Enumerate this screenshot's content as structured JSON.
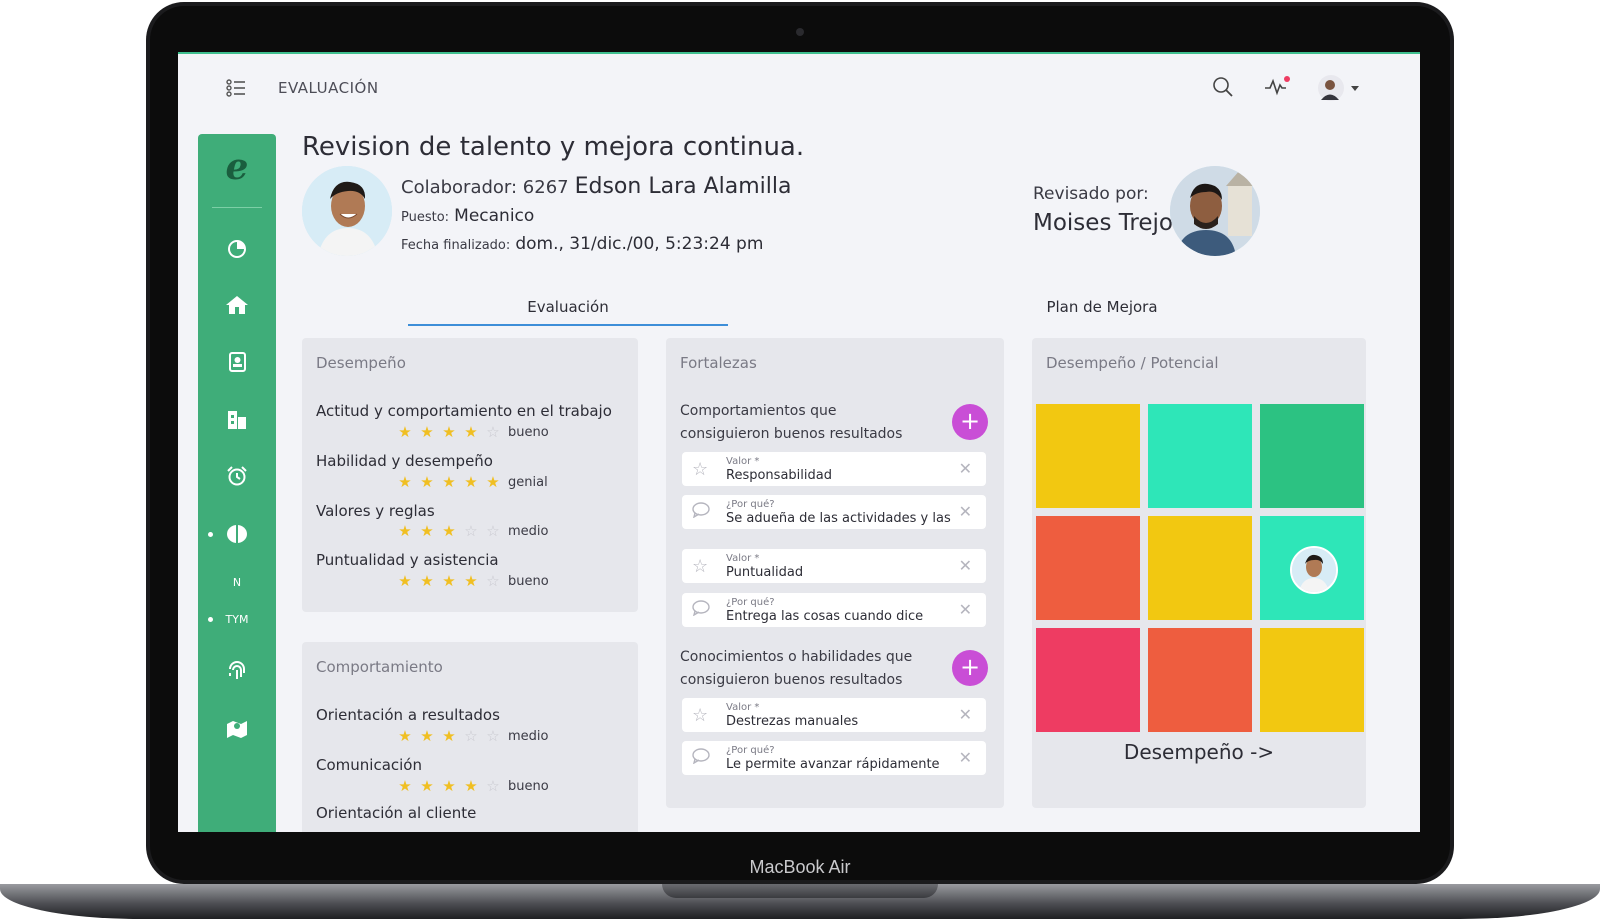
{
  "topbar": {
    "page_name": "EVALUACIÓN"
  },
  "sidebar": {
    "logo": "e",
    "labels": {
      "n": "N",
      "tym": "TYM"
    },
    "icons": [
      "chart-pie-icon",
      "home-icon",
      "contacts-icon",
      "building-icon",
      "alarm-clock-icon",
      "brain-icon",
      "fingerprint-icon",
      "map-icon"
    ]
  },
  "header": {
    "title": "Revision de talento y mejora continua.",
    "colaborador_label": "Colaborador: 6267",
    "colaborador_name": "Edson Lara Alamilla",
    "puesto_label": "Puesto:",
    "puesto_value": "Mecanico",
    "fecha_label": "Fecha finalizado:",
    "fecha_value": "dom., 31/dic./00, 5:23:24 pm",
    "reviewed_label": "Revisado por:",
    "reviewed_name": "Moises Trejo"
  },
  "tabs": [
    {
      "label": "Evaluación",
      "active": true
    },
    {
      "label": "Plan de Mejora",
      "active": false
    }
  ],
  "desempeno": {
    "title": "Desempeño",
    "items": [
      {
        "name": "Actitud y comportamiento en el trabajo",
        "stars": 4,
        "rating": "bueno"
      },
      {
        "name": "Habilidad y desempeño",
        "stars": 5,
        "rating": "genial"
      },
      {
        "name": "Valores y reglas",
        "stars": 3,
        "rating": "medio"
      },
      {
        "name": "Puntualidad y asistencia",
        "stars": 4,
        "rating": "bueno"
      }
    ]
  },
  "comportamiento": {
    "title": "Comportamiento",
    "items": [
      {
        "name": "Orientación a resultados",
        "stars": 3,
        "rating": "medio"
      },
      {
        "name": "Comunicación",
        "stars": 4,
        "rating": "bueno"
      },
      {
        "name": "Orientación al cliente"
      }
    ]
  },
  "fortalezas": {
    "title": "Fortalezas",
    "section1": "Comportamientos que consiguieron buenos resultados",
    "section2": "Conocimientos o habilidades que consiguieron buenos resultados",
    "valor_label": "Valor *",
    "porque_label": "¿Por qué?",
    "entries": [
      {
        "valor": "Responsabilidad",
        "porque": "Se adueña de las actividades y las"
      },
      {
        "valor": "Puntualidad",
        "porque": "Entrega las cosas cuando dice"
      },
      {
        "valor": "Destrezas manuales",
        "porque": "Le permite avanzar rápidamente"
      }
    ]
  },
  "potencial": {
    "title": "Desempeño / Potencial",
    "caption": "Desempeño ->",
    "colors": [
      "#f2c811",
      "#2ee6b8",
      "#2cc282",
      "#ee5d3f",
      "#f2c811",
      "#2ee6b8",
      "#ee3c62",
      "#ee5d3f",
      "#f2c811"
    ],
    "avatar_cell": 5
  },
  "device": {
    "label": "MacBook Air"
  }
}
